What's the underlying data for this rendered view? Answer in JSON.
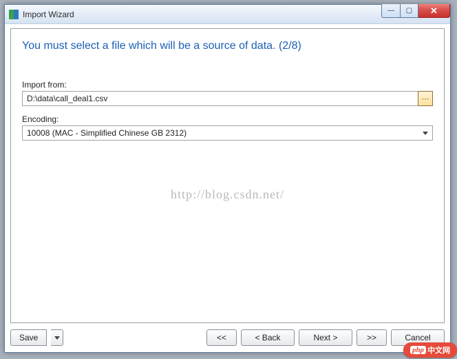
{
  "window": {
    "title": "Import Wizard"
  },
  "headline": "You must select a file which will be a source of data. (2/8)",
  "fields": {
    "import_from": {
      "label": "Import from:",
      "value": "D:\\data\\call_deal1.csv"
    },
    "encoding": {
      "label": "Encoding:",
      "value": "10008 (MAC - Simplified Chinese GB 2312)"
    }
  },
  "watermark": "http://blog.csdn.net/",
  "footer": {
    "save": "Save",
    "first": "<<",
    "back": "<  Back",
    "next": "Next  >",
    "last": ">>",
    "cancel": "Cancel"
  },
  "badge": {
    "prefix": "php",
    "text": "中文网"
  }
}
